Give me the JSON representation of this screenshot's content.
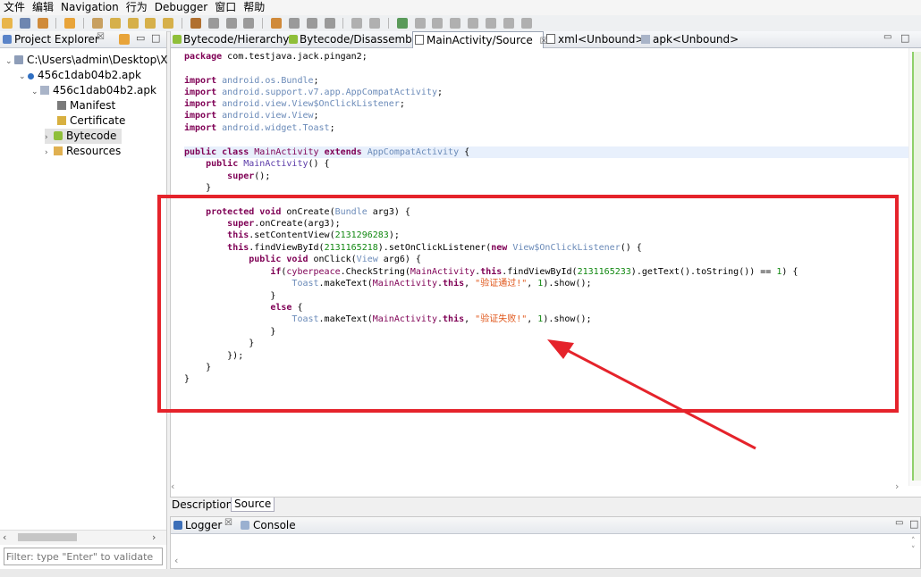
{
  "menubar": {
    "items": [
      "文件",
      "编辑",
      "Navigation",
      "行为",
      "Debugger",
      "窗口",
      "帮助"
    ]
  },
  "explorer": {
    "tab_label": "Project Explorer",
    "tab_close": "☒",
    "filter_placeholder": "Filter: type \"Enter\" to validate",
    "tree": [
      {
        "label": "C:\\Users\\admin\\Desktop\\X",
        "icon": "folder-icon"
      },
      {
        "label": "456c1dab04b2.apk",
        "icon": "apk-dot-icon"
      },
      {
        "label": "456c1dab04b2.apk",
        "icon": "apk-file-icon"
      },
      {
        "label": "Manifest",
        "icon": "manifest-icon"
      },
      {
        "label": "Certificate",
        "icon": "certificate-icon"
      },
      {
        "label": "Bytecode",
        "icon": "android-icon"
      },
      {
        "label": "Resources",
        "icon": "folder-icon"
      }
    ]
  },
  "editor": {
    "tabs": [
      {
        "label": "Bytecode/Hierarchy",
        "icon": "android-icon"
      },
      {
        "label": "Bytecode/Disassembly",
        "icon": "android-icon"
      },
      {
        "label": "MainActivity/Source",
        "icon": "java-file-icon",
        "close": "☒"
      },
      {
        "label": "xml<Unbound>",
        "icon": "xml-icon"
      },
      {
        "label": "apk<Unbound>",
        "icon": "apk-file-icon"
      }
    ],
    "code_lines": [
      "package com.testjava.jack.pingan2;",
      "",
      "import android.os.Bundle;",
      "import android.support.v7.app.AppCompatActivity;",
      "import android.view.View$OnClickListener;",
      "import android.view.View;",
      "import android.widget.Toast;",
      "",
      "public class MainActivity extends AppCompatActivity {",
      "    public MainActivity() {",
      "        super();",
      "    }",
      "",
      "    protected void onCreate(Bundle arg3) {",
      "        super.onCreate(arg3);",
      "        this.setContentView(2131296283);",
      "        this.findViewById(2131165218).setOnClickListener(new View$OnClickListener() {",
      "            public void onClick(View arg6) {",
      "                if(cyberpeace.CheckString(MainActivity.this.findViewById(2131165233).getText().toString()) == 1) {",
      "                    Toast.makeText(MainActivity.this, \"验证通过!\", 1).show();",
      "                }",
      "                else {",
      "                    Toast.makeText(MainActivity.this, \"验证失败!\", 1).show();",
      "                }",
      "            }",
      "        });",
      "    }",
      "}"
    ],
    "bottom_tabs": [
      "Description",
      "Source"
    ]
  },
  "console": {
    "tabs": [
      {
        "label": "Logger",
        "icon": "logger-icon",
        "close": "☒"
      },
      {
        "label": "Console",
        "icon": "console-icon"
      }
    ]
  },
  "colors": {
    "annotation": "#e5232b",
    "keyword": "#7f0055",
    "type": "#6a8ab8",
    "string": "#e0571b",
    "number": "#118811"
  }
}
